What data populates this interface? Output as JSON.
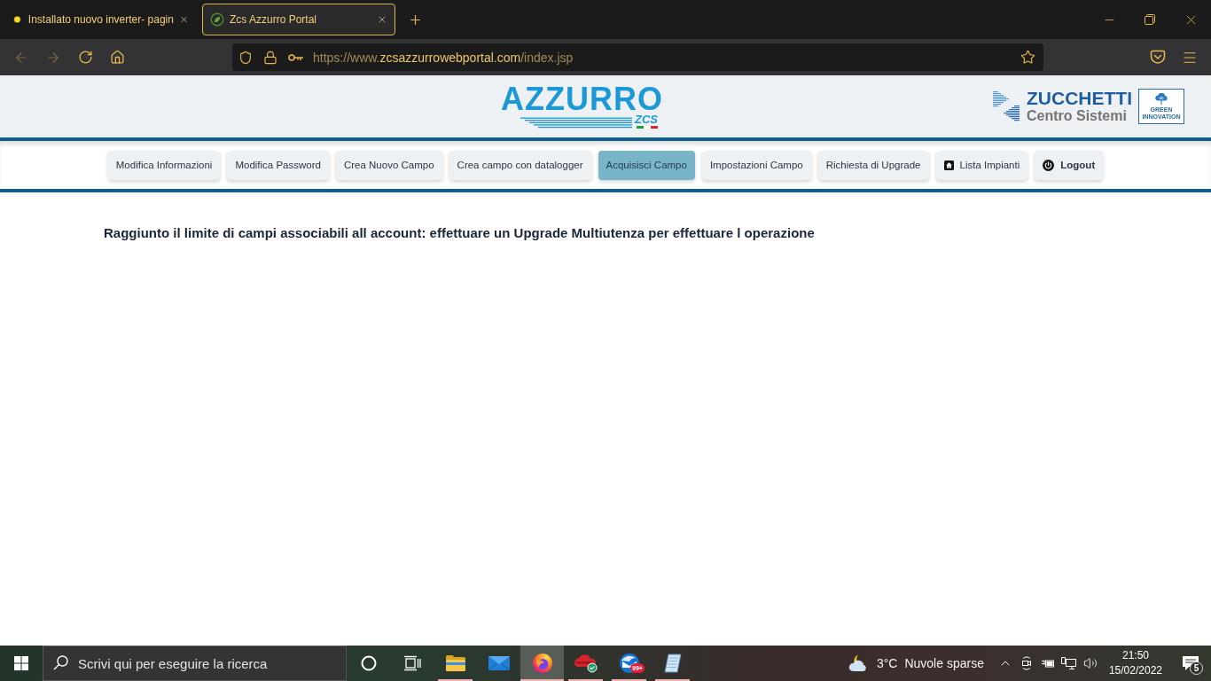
{
  "browser": {
    "tabs": [
      {
        "kind": "article",
        "title": "Installato nuovo inverter- pagin",
        "selected": false
      },
      {
        "kind": "portal",
        "title": "Zcs Azzurro Portal",
        "selected": true
      }
    ],
    "back_disabled": true,
    "forward_disabled": true,
    "url": {
      "scheme": "https://www.",
      "host": "zcsazzurrowebportal.com",
      "path": "/index.jsp"
    }
  },
  "header": {
    "logo": {
      "wordmark": "AZZURRO",
      "subtitle": "ZCS"
    },
    "company": {
      "name": "ZUCCHETTI",
      "division": "Centro Sistemi",
      "badge": "GREEN INNOVATION"
    }
  },
  "nav": [
    {
      "kind": "text",
      "label": "Modifica Informazioni",
      "selected": false
    },
    {
      "kind": "text",
      "label": "Modifica Password",
      "selected": false
    },
    {
      "kind": "text",
      "label": "Crea Nuovo Campo",
      "selected": false
    },
    {
      "kind": "text",
      "label": "Crea campo con datalogger",
      "selected": false
    },
    {
      "kind": "text",
      "label": "Acquisisci Campo",
      "selected": true
    },
    {
      "kind": "text",
      "label": "Impostazioni Campo",
      "selected": false
    },
    {
      "kind": "text",
      "label": "Richiesta di Upgrade",
      "selected": false
    },
    {
      "kind": "home",
      "label": "Lista Impianti",
      "selected": false
    },
    {
      "kind": "logout",
      "label": "Logout",
      "selected": false
    }
  ],
  "message": "Raggiunto il limite di campi associabili all account: effettuare un Upgrade Multiutenza per effettuare l operazione",
  "taskbar": {
    "search": {
      "placeholder": "Scrivi qui per eseguire la ricerca"
    },
    "apps": [
      {
        "kind": "folder",
        "running": true,
        "selected": false
      },
      {
        "kind": "mail",
        "running": false,
        "selected": false
      },
      {
        "kind": "browser",
        "running": true,
        "selected": true
      },
      {
        "kind": "cloud",
        "running": true,
        "selected": false
      },
      {
        "kind": "mailclient",
        "running": true,
        "selected": false,
        "badge": "99+"
      },
      {
        "kind": "notepad",
        "running": true,
        "selected": false
      }
    ],
    "weather": {
      "temperature": "3°C",
      "condition": "Nuvole sparse"
    },
    "clock": {
      "time": "21:50",
      "date": "15/02/2022"
    },
    "notifications": "5"
  }
}
